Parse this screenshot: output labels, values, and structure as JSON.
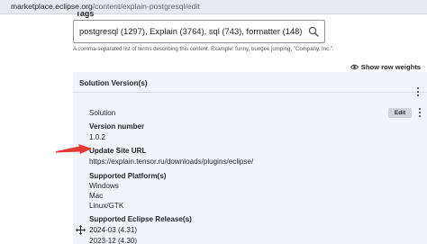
{
  "browser": {
    "url_host": "marketplace.eclipse.org",
    "url_path": "/content/explain-postgresql/edit"
  },
  "tags": {
    "label": "Tags",
    "value": "postgresql (1297), Explain (3764), sql (743), formatter (148)",
    "help": "A comma-separated list of terms describing this content. Example: funny, bungee jumping, \"Company, Inc.\"."
  },
  "show_row_weights": "Show row weights",
  "solution_version": {
    "title": "Solution Version(s)",
    "solution_label": "Solution",
    "edit_label": "Edit",
    "version_number_label": "Version number",
    "version_number": "1.0.2",
    "update_site_label": "Update Site URL",
    "update_site_url": "https://explain.tensor.ru/downloads/plugins/eclipse/",
    "platforms_label": "Supported Platform(s)",
    "platforms": [
      "Windows",
      "Mac",
      "Linux/GTK"
    ],
    "releases_label": "Supported Eclipse Release(s)",
    "releases": [
      "2024-03 (4.31)",
      "2023-12 (4.30)"
    ]
  },
  "colors": {
    "accent_arrow": "#e53935",
    "panel_bg": "#f3f4f9"
  },
  "icons": [
    "lock-icon",
    "search-icon",
    "eye-icon",
    "kebab-menu-icon",
    "red-arrow-icon",
    "move-icon"
  ]
}
